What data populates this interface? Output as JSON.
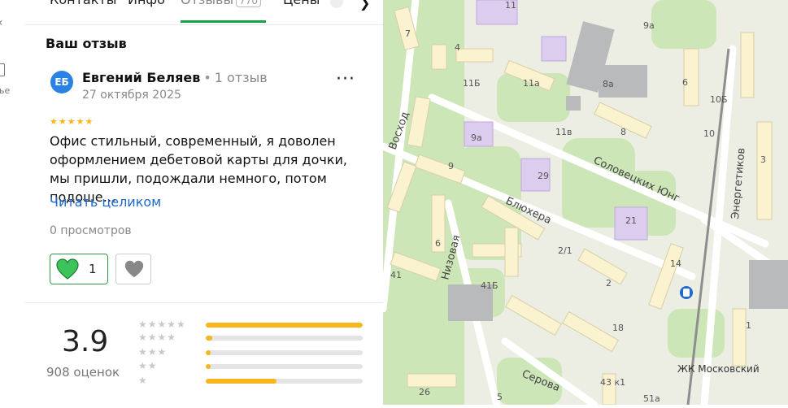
{
  "sidebar_fragments": {
    "letter_tail": "ье",
    "chevron": "‹"
  },
  "tabs": [
    {
      "label": "Контакты"
    },
    {
      "label": "Инфо"
    },
    {
      "label": "Отзывы",
      "count": "770"
    },
    {
      "label": "Цены"
    }
  ],
  "review_section": {
    "title": "Ваш отзыв",
    "author": {
      "initials": "ЕБ",
      "name": "Евгений Беляев",
      "reviews_count": "1 отзыв",
      "date": "27 октября 2025"
    },
    "stars": "★★★★★",
    "text": "Офис стильный, современный, я доволен оформлением дебетовой карты для дочки, мы пришли, подождали немного, потом подоше…",
    "read_more": "Читать целиком",
    "views": "0 просмотров",
    "likes": "1"
  },
  "rating": {
    "score": "3.9",
    "count_label": "908 оценок",
    "distribution": [
      {
        "stars": "★★★★★",
        "fraction": 1.0
      },
      {
        "stars": "★★★★",
        "fraction": 0.04
      },
      {
        "stars": "★★★",
        "fraction": 0.03
      },
      {
        "stars": "★★",
        "fraction": 0.03
      },
      {
        "stars": "★",
        "fraction": 0.45
      }
    ]
  },
  "map": {
    "streets": [
      "Восход",
      "Соловецких Юнг",
      "Блюхера",
      "Низовая",
      "Энергетиков",
      "Серова"
    ],
    "house_numbers": [
      "11",
      "9а",
      "7",
      "4",
      "11Б",
      "11а",
      "8а",
      "6",
      "10Б",
      "9а",
      "11в",
      "8",
      "10",
      "3",
      "9",
      "29",
      "21",
      "6",
      "2/1",
      "14",
      "41",
      "41Б",
      "2",
      "18",
      "1",
      "43 к1",
      "26",
      "5",
      "51а"
    ],
    "poi": "ЖК Московский",
    "colors": {
      "bg": "#eceee4",
      "green": "#cde6b8",
      "building": "#fbf3cf",
      "school": "#dccdee",
      "road": "#ffffff",
      "rail": "#8e8e8e"
    }
  }
}
